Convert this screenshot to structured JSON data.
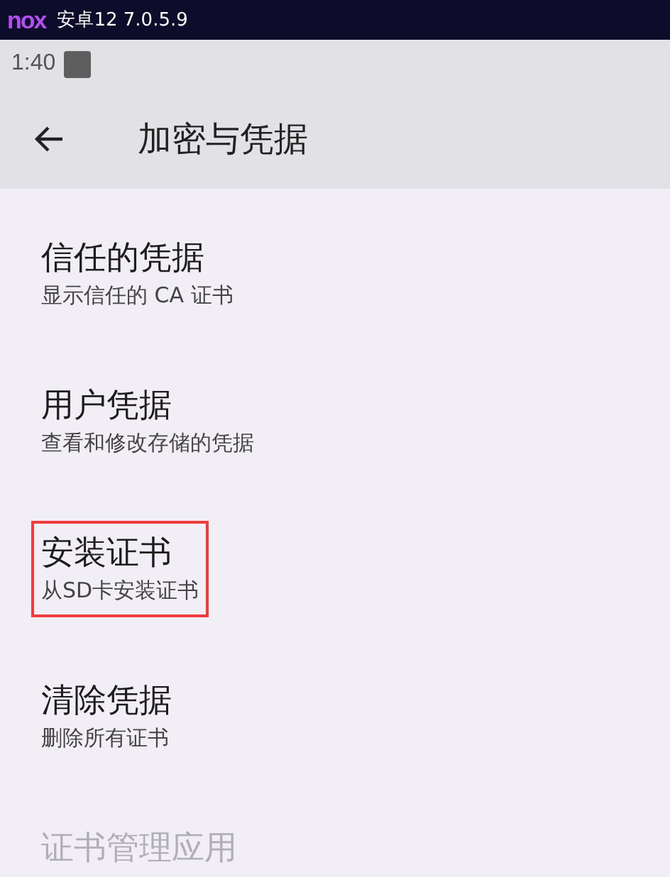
{
  "emulator_bar": {
    "logo": "nox",
    "title": "安卓12 7.0.5.9"
  },
  "status_bar": {
    "time": "1:40"
  },
  "app_bar": {
    "title": "加密与凭据"
  },
  "items": [
    {
      "title": "信任的凭据",
      "subtitle": "显示信任的 CA 证书",
      "highlighted": false,
      "disabled": false
    },
    {
      "title": "用户凭据",
      "subtitle": "查看和修改存储的凭据",
      "highlighted": false,
      "disabled": false
    },
    {
      "title": "安装证书",
      "subtitle": "从SD卡安装证书",
      "highlighted": true,
      "disabled": false
    },
    {
      "title": "清除凭据",
      "subtitle": "删除所有证书",
      "highlighted": false,
      "disabled": false
    },
    {
      "title": "证书管理应用",
      "highlighted": false,
      "disabled": true
    }
  ]
}
